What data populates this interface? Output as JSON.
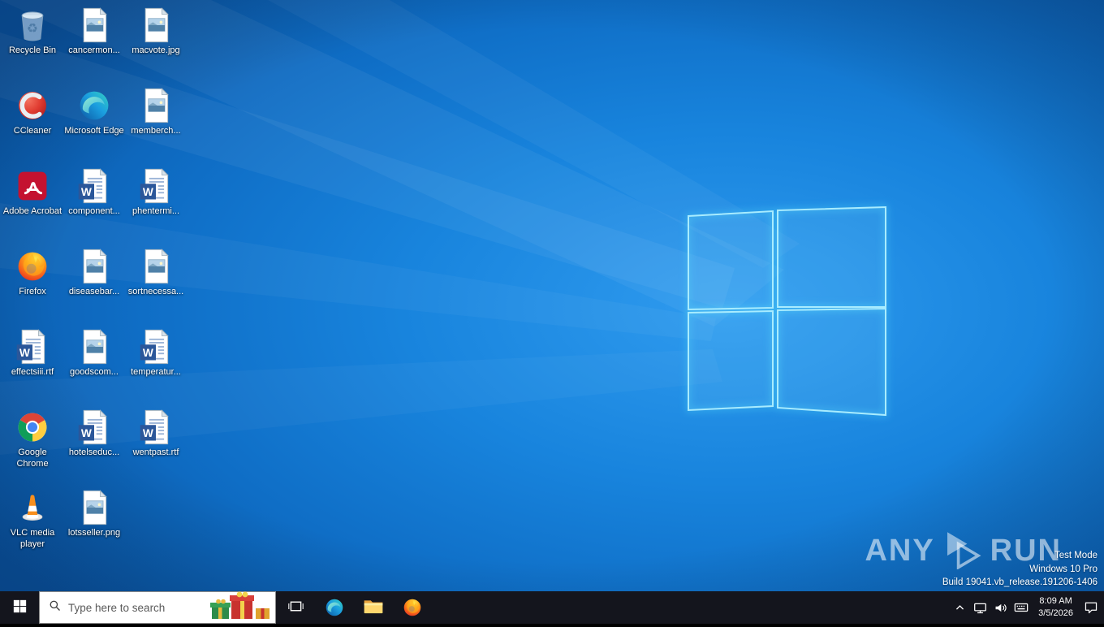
{
  "desktop": {
    "icons": [
      {
        "label": "Recycle Bin",
        "type": "recycle-bin",
        "col": 0,
        "row": 0
      },
      {
        "label": "cancermon...",
        "type": "image-file",
        "col": 1,
        "row": 0
      },
      {
        "label": "macvote.jpg",
        "type": "image-file",
        "col": 2,
        "row": 0
      },
      {
        "label": "CCleaner",
        "type": "ccleaner",
        "col": 0,
        "row": 1
      },
      {
        "label": "Microsoft Edge",
        "type": "edge",
        "col": 1,
        "row": 1
      },
      {
        "label": "memberch...",
        "type": "image-file",
        "col": 2,
        "row": 1
      },
      {
        "label": "Adobe Acrobat",
        "type": "acrobat",
        "col": 0,
        "row": 2
      },
      {
        "label": "component...",
        "type": "word-file",
        "col": 1,
        "row": 2
      },
      {
        "label": "phentermi...",
        "type": "word-file",
        "col": 2,
        "row": 2
      },
      {
        "label": "Firefox",
        "type": "firefox",
        "col": 0,
        "row": 3
      },
      {
        "label": "diseasebar...",
        "type": "image-file",
        "col": 1,
        "row": 3
      },
      {
        "label": "sortnecessa...",
        "type": "image-file",
        "col": 2,
        "row": 3
      },
      {
        "label": "effectsiii.rtf",
        "type": "word-file",
        "col": 0,
        "row": 4
      },
      {
        "label": "goodscom...",
        "type": "image-file",
        "col": 1,
        "row": 4
      },
      {
        "label": "temperatur...",
        "type": "word-file",
        "col": 2,
        "row": 4
      },
      {
        "label": "Google Chrome",
        "type": "chrome",
        "col": 0,
        "row": 5
      },
      {
        "label": "hotelseduc...",
        "type": "word-file",
        "col": 1,
        "row": 5
      },
      {
        "label": "wentpast.rtf",
        "type": "word-file",
        "col": 2,
        "row": 5
      },
      {
        "label": "VLC media player",
        "type": "vlc",
        "col": 0,
        "row": 6
      },
      {
        "label": "lotsseller.png",
        "type": "image-file",
        "col": 1,
        "row": 6
      }
    ]
  },
  "watermark": {
    "brand_left": "ANY",
    "brand_right": "RUN"
  },
  "system_info": {
    "lines": [
      "Test Mode",
      "Windows 10 Pro",
      "Build 19041.vb_release.191206-1406"
    ]
  },
  "taskbar": {
    "search_placeholder": "Type here to search",
    "clock": {
      "time": "8:09 AM",
      "date": "3/5/2026"
    }
  },
  "colors": {
    "taskbar_bg": "#14151d",
    "wallpaper_accent": "#1884dd",
    "logo_glow": "#a8ecff"
  }
}
